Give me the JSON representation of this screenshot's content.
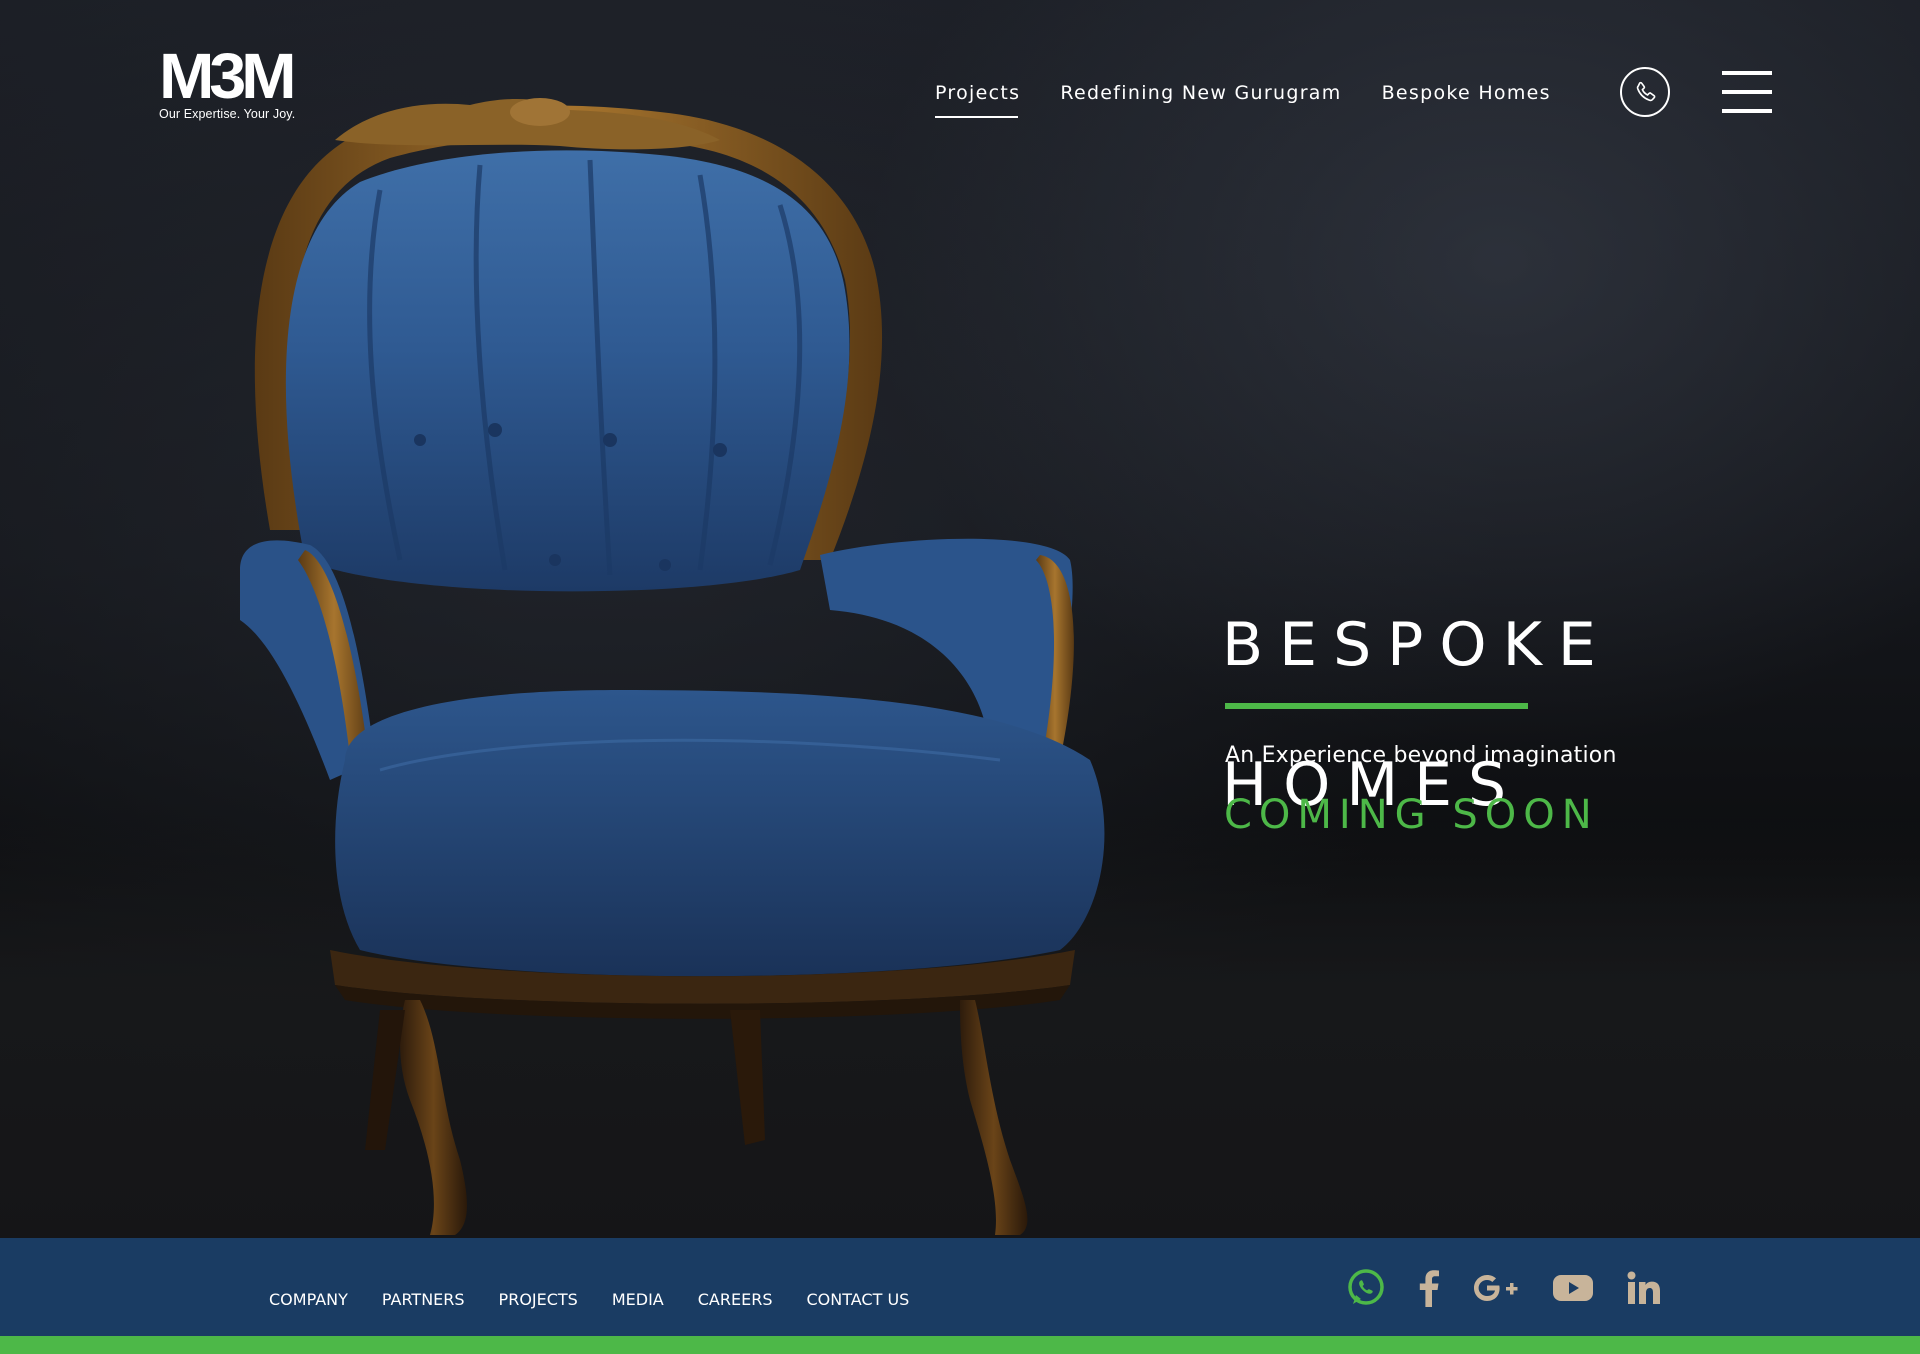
{
  "header": {
    "logo": {
      "mark": "M3M",
      "tagline": "Our Expertise. Your Joy."
    },
    "nav": [
      {
        "label": "Projects",
        "active": true
      },
      {
        "label": "Redefining New Gurugram",
        "active": false
      },
      {
        "label": "Bespoke Homes",
        "active": false
      }
    ],
    "icons": {
      "phone": "phone-icon",
      "menu": "hamburger-menu-icon"
    }
  },
  "hero": {
    "title_line1": "BESPOKE",
    "title_line2": "HOMES",
    "tagline": "An Experience beyond imagination",
    "status": "COMING SOON",
    "image": "blue-velvet-armchair"
  },
  "footer": {
    "links": [
      "COMPANY",
      "PARTNERS",
      "PROJECTS",
      "MEDIA",
      "CAREERS",
      "CONTACT US"
    ],
    "social": [
      "whatsapp-icon",
      "facebook-icon",
      "google-plus-icon",
      "youtube-icon",
      "linkedin-icon"
    ]
  },
  "colors": {
    "accent_green": "#4db848",
    "footer_blue": "#1a3c63",
    "social_icon": "#c8b49a",
    "text": "#ffffff"
  }
}
